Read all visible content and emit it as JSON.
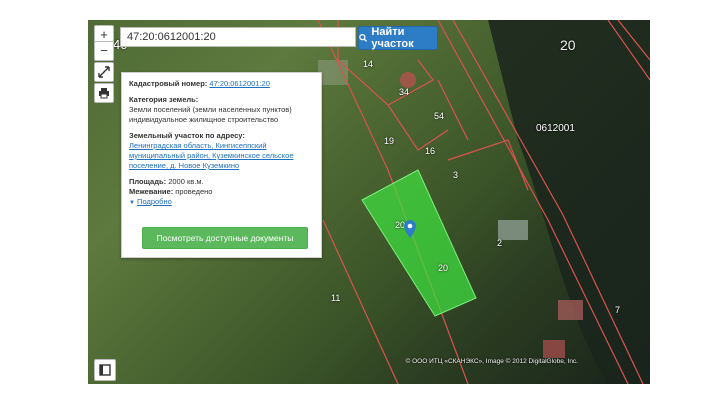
{
  "search": {
    "value": "47:20:0612001:20",
    "button_label": "Найти участок"
  },
  "map": {
    "labels": {
      "l40": "40",
      "l20_top": "20",
      "l14": "14",
      "l34": "34",
      "l54": "54",
      "l19": "19",
      "l16": "16",
      "l3": "3",
      "block": "0612001",
      "l20_parcel": "20",
      "l20_parcel2": "20",
      "l2": "2",
      "l11": "11",
      "l7": "7"
    },
    "attribution": "© ООО ИТЦ «СКАНЭКС», Image © 2012 DigitalGlobe, Inc."
  },
  "controls": {
    "zoom_in": "+",
    "zoom_out": "−"
  },
  "info": {
    "cadastral_label": "Кадастровый номер:",
    "cadastral_value": "47:20:0612001:20",
    "category_label": "Категория земель:",
    "category_value": "Земли поселений (земли населенных пунктов)",
    "usage_value": "индивидуальное жилищное строительство",
    "address_label": "Земельный участок по адресу:",
    "address_value": "Ленинградская область, Кингисеппский муниципальный район, Куземкинское сельское поселение, д. Новое Куземкино",
    "area_label": "Площадь:",
    "area_value": "2000 кв.м.",
    "survey_label": "Межевание:",
    "survey_value": "проведено",
    "details_link": "Подробно",
    "docs_button": "Посмотреть доступные документы"
  },
  "colors": {
    "parcel_fill": "#3fdc3f",
    "boundary": "#d9534f",
    "accent": "#2d7cc6"
  }
}
